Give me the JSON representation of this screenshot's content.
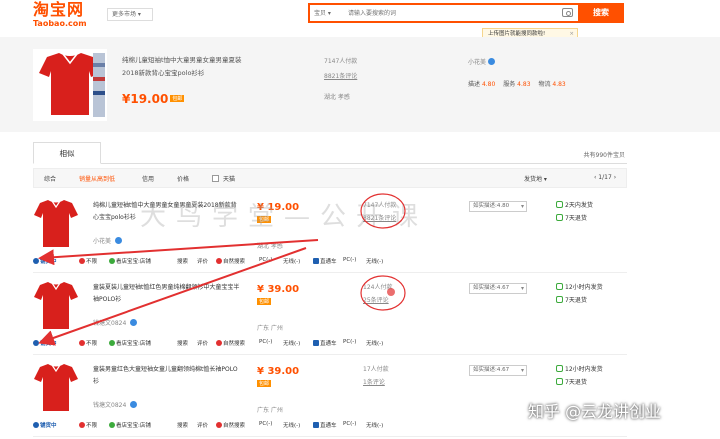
{
  "header": {
    "logo_cn": "淘宝网",
    "logo_en": "Taobao.com",
    "market_label": "更多市场 ▾",
    "search_type": "宝贝 ▾",
    "search_placeholder": "请输入要搜索的词",
    "search_button": "搜索",
    "upload_tip": "上传图片就能搜同款啦!",
    "tip_close": "×"
  },
  "summary": {
    "title": "纯棉儿童短袖t恤中大童男童女童男童夏装2018新款背心宝宝polo衫衫",
    "price": "¥19.00",
    "badge": "包邮",
    "paid": "7147人付款",
    "reviews": "8821条评论",
    "location": "湖北 孝感",
    "shop": "小花美",
    "dsr": [
      {
        "label": "描述",
        "value": "4.80"
      },
      {
        "label": "服务",
        "value": "4.83"
      },
      {
        "label": "物流",
        "value": "4.83"
      }
    ]
  },
  "tabs": {
    "similar": "相似",
    "total": "共有990件宝贝"
  },
  "sort": {
    "items": [
      "综合",
      "销量从高到低",
      "信用",
      "价格"
    ],
    "active_index": 1,
    "checkbox_label": "天猫",
    "location_filter": "发货地 ▾",
    "pager": "‹  1/17  ›"
  },
  "rows": [
    {
      "title": "纯棉儿童短袖t恤中大童男童女童男童夏装2018新款背心宝宝polo衫衫",
      "price": "¥ 19.00",
      "badge": "包邮",
      "shop": "小花美",
      "location": "湖北 孝感",
      "paid": "7147人付款",
      "reviews": "8821条评论",
      "select": "如实描述:4.80",
      "svc1": "2天内发货",
      "svc2": "7天退货",
      "svc1_color": "#3caa3c",
      "svc2_color": "#3caa3c"
    },
    {
      "title": "童装夏装儿童短袖t恤红色男童纯棉翻领衫中大童宝宝半袖POLO衫",
      "price": "¥ 39.00",
      "badge": "包邮",
      "shop": "钱塘文0824",
      "location": "广东 广州",
      "paid": "124人付款",
      "reviews": "25条评论",
      "select": "如实描述:4.67",
      "svc1": "12小时内发货",
      "svc2": "7天退货",
      "svc1_color": "#3caa3c",
      "svc2_color": "#3caa3c"
    },
    {
      "title": "童装男童红色大童短袖女童儿童翻领纯棉t恤长袖POLO衫",
      "price": "¥ 39.00",
      "badge": "包邮",
      "shop": "钱塘文0824",
      "location": "广东 广州",
      "paid": "17人付款",
      "reviews": "1条评论",
      "select": "如实描述:4.67",
      "svc1": "12小时内发货",
      "svc2": "7天退货",
      "svc1_color": "#3caa3c",
      "svc2_color": "#3caa3c"
    }
  ],
  "row_actions": {
    "promote": "铺货中",
    "nobuy": "不限",
    "view_shop": "看店宝宝:店铺",
    "search": "搜索",
    "review": "评价",
    "natural": "自然搜索",
    "pc": "PC(-)",
    "wireless": "无线(-)",
    "direct": "直通车",
    "pc2": "PC(-)",
    "wireless2": "无线(-)"
  },
  "overlay": {
    "watermark": "大鸟学堂—公开课",
    "zhihu": "知乎 @云龙讲创业"
  },
  "colors": {
    "brand": "#ff5000",
    "badge": "#ff9000",
    "annotation": "#e23030"
  }
}
